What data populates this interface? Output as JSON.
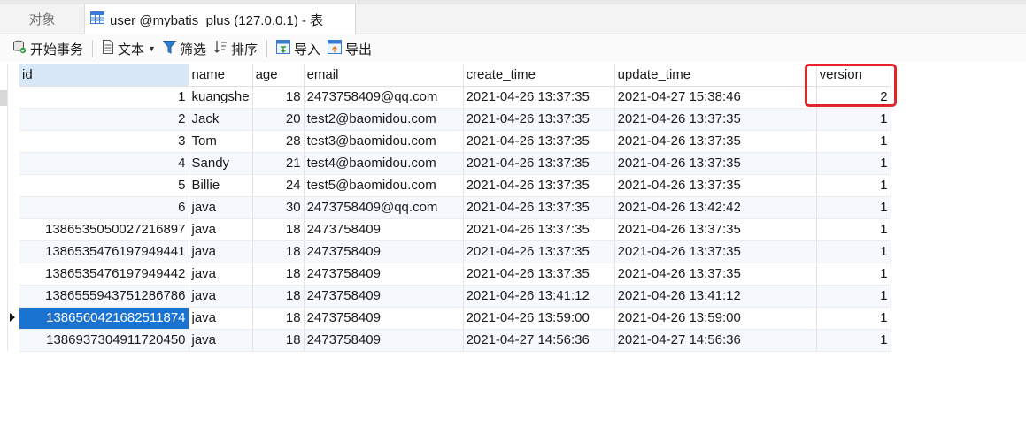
{
  "tabs": {
    "objects_label": "对象",
    "table_label": "user @mybatis_plus (127.0.0.1) - 表"
  },
  "toolbar": {
    "begin_tx": "开始事务",
    "text": "文本",
    "filter": "筛选",
    "sort": "排序",
    "import": "导入",
    "export": "导出"
  },
  "grid": {
    "columns": [
      "id",
      "name",
      "age",
      "email",
      "create_time",
      "update_time",
      "version"
    ],
    "rows": [
      [
        "1",
        "kuangshe",
        "18",
        "2473758409@qq.com",
        "2021-04-26 13:37:35",
        "2021-04-27 15:38:46",
        "2"
      ],
      [
        "2",
        "Jack",
        "20",
        "test2@baomidou.com",
        "2021-04-26 13:37:35",
        "2021-04-26 13:37:35",
        "1"
      ],
      [
        "3",
        "Tom",
        "28",
        "test3@baomidou.com",
        "2021-04-26 13:37:35",
        "2021-04-26 13:37:35",
        "1"
      ],
      [
        "4",
        "Sandy",
        "21",
        "test4@baomidou.com",
        "2021-04-26 13:37:35",
        "2021-04-26 13:37:35",
        "1"
      ],
      [
        "5",
        "Billie",
        "24",
        "test5@baomidou.com",
        "2021-04-26 13:37:35",
        "2021-04-26 13:37:35",
        "1"
      ],
      [
        "6",
        "java",
        "30",
        "2473758409@qq.com",
        "2021-04-26 13:37:35",
        "2021-04-26 13:42:42",
        "1"
      ],
      [
        "1386535050027216897",
        "java",
        "18",
        "2473758409",
        "2021-04-26 13:37:35",
        "2021-04-26 13:37:35",
        "1"
      ],
      [
        "1386535476197949441",
        "java",
        "18",
        "2473758409",
        "2021-04-26 13:37:35",
        "2021-04-26 13:37:35",
        "1"
      ],
      [
        "1386535476197949442",
        "java",
        "18",
        "2473758409",
        "2021-04-26 13:37:35",
        "2021-04-26 13:37:35",
        "1"
      ],
      [
        "1386555943751286786",
        "java",
        "18",
        "2473758409",
        "2021-04-26 13:41:12",
        "2021-04-26 13:41:12",
        "1"
      ],
      [
        "1386560421682511874",
        "java",
        "18",
        "2473758409",
        "2021-04-26 13:59:00",
        "2021-04-26 13:59:00",
        "1"
      ],
      [
        "1386937304911720450",
        "java",
        "18",
        "2473758409",
        "2021-04-27 14:56:36",
        "2021-04-27 14:56:36",
        "1"
      ]
    ],
    "selected_row": 10,
    "sorted_column": "id"
  },
  "colors": {
    "selection": "#1a73d1",
    "highlight_box": "#e0262a",
    "sorted_header": "#d9e8f7"
  },
  "icons": [
    "table-icon",
    "transaction-icon",
    "text-icon",
    "filter-icon",
    "sort-icon",
    "import-icon",
    "export-icon"
  ]
}
